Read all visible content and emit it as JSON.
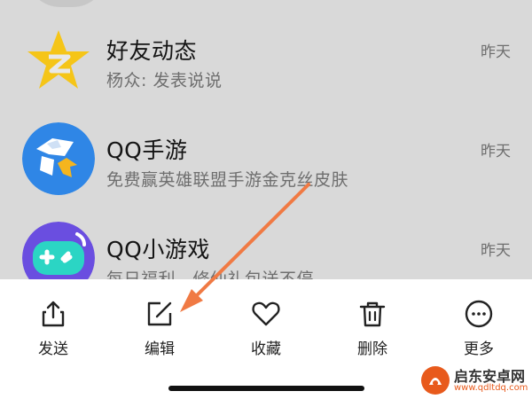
{
  "chat_list": {
    "items": [
      {
        "title": "好友动态",
        "subtitle": "杨众: 发表说说",
        "time": "昨天",
        "avatar_icon": "qzone-star-icon"
      },
      {
        "title": "QQ手游",
        "subtitle": "免费赢英雄联盟手游金克丝皮肤",
        "time": "昨天",
        "avatar_icon": "qq-mobile-games-icon"
      },
      {
        "title": "QQ小游戏",
        "subtitle": "每日福利，修仙礼包送不停",
        "time": "昨天",
        "avatar_icon": "gamepad-icon"
      }
    ]
  },
  "action_sheet": {
    "actions": [
      {
        "label": "发送",
        "icon": "share-icon"
      },
      {
        "label": "编辑",
        "icon": "edit-icon"
      },
      {
        "label": "收藏",
        "icon": "heart-icon"
      },
      {
        "label": "删除",
        "icon": "trash-icon"
      },
      {
        "label": "更多",
        "icon": "more-icon"
      }
    ]
  },
  "annotation": {
    "color": "#f07a44"
  },
  "watermark": {
    "name": "启东安卓网",
    "url": "www.qdltdq.com"
  },
  "colors": {
    "dim_overlay": "#d9d9d9",
    "qzone_yellow": "#f5c518",
    "qq_games_blue": "#2f86e6",
    "mini_games_purple": "#6a4ee0",
    "mini_games_teal": "#2bd5c4"
  }
}
